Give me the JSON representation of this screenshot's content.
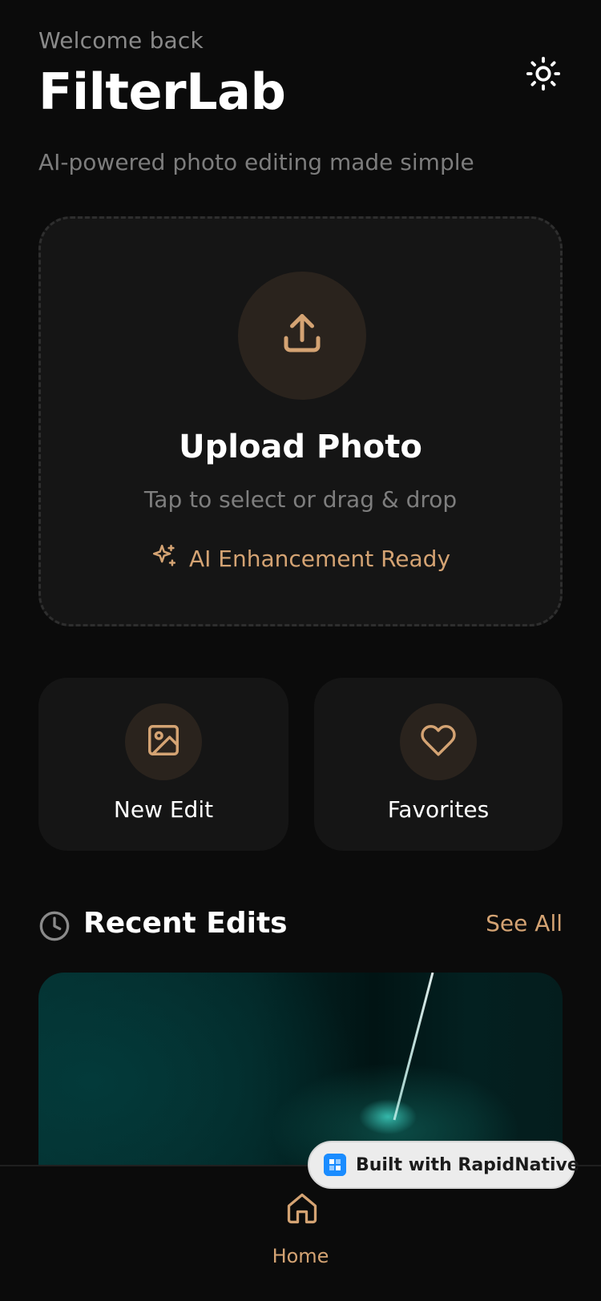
{
  "header": {
    "welcome": "Welcome back",
    "title": "FilterLab",
    "tagline": "AI-powered photo editing made simple",
    "theme_icon": "sun-icon"
  },
  "upload": {
    "title": "Upload Photo",
    "subtitle": "Tap to select or drag & drop",
    "ai_label": "AI Enhancement Ready",
    "icon": "upload-icon",
    "ai_icon": "sparkles-icon"
  },
  "actions": [
    {
      "label": "New Edit",
      "icon": "image-icon"
    },
    {
      "label": "Favorites",
      "icon": "heart-icon"
    }
  ],
  "recent": {
    "title": "Recent Edits",
    "see_all": "See All",
    "icon": "clock-icon"
  },
  "nav": {
    "home_label": "Home",
    "home_icon": "home-icon"
  },
  "badge": {
    "text": "Built with RapidNative"
  },
  "colors": {
    "background": "#0b0b0b",
    "card": "#151515",
    "accent": "#d4a373",
    "accent_circle": "#2a231d",
    "muted_text": "#7e7e7e"
  }
}
